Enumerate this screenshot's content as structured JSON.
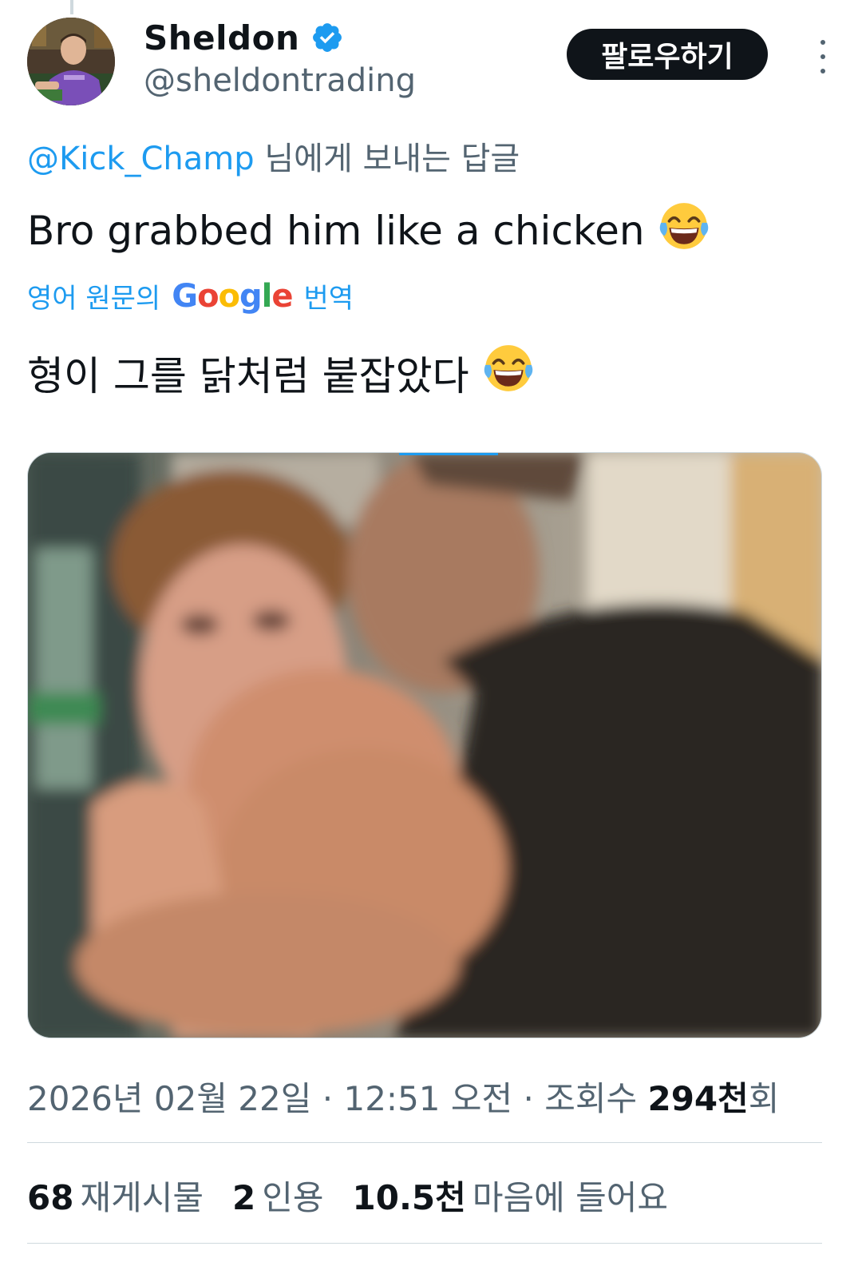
{
  "author": {
    "display_name": "Sheldon",
    "handle": "@sheldontrading",
    "verified": true
  },
  "actions": {
    "follow_label": "팔로우하기"
  },
  "reply": {
    "mention": "@Kick_Champ",
    "suffix": " 님에게 보내는 답글"
  },
  "tweet": {
    "text": "Bro grabbed him like a chicken",
    "emoji": "face-with-tears-of-joy"
  },
  "translation": {
    "prefix": "영어 원문의",
    "brand": "Google",
    "suffix": "번역",
    "text": "형이 그를 닭처럼 붙잡았다"
  },
  "meta": {
    "date": "2026년 02월 22일",
    "separator1": " · ",
    "time": "12:51 오전",
    "separator2": " · ",
    "views_label": "조회수 ",
    "views_value": "294천",
    "views_unit": "회"
  },
  "stats": {
    "retweets_value": "68",
    "retweets_label": "재게시물",
    "quotes_value": "2",
    "quotes_label": "인용",
    "likes_value": "10.5천",
    "likes_label": "마음에 들어요"
  },
  "colors": {
    "accent": "#1d9bf0",
    "text_primary": "#0f1419",
    "text_secondary": "#536471",
    "button_bg": "#0f1419"
  }
}
